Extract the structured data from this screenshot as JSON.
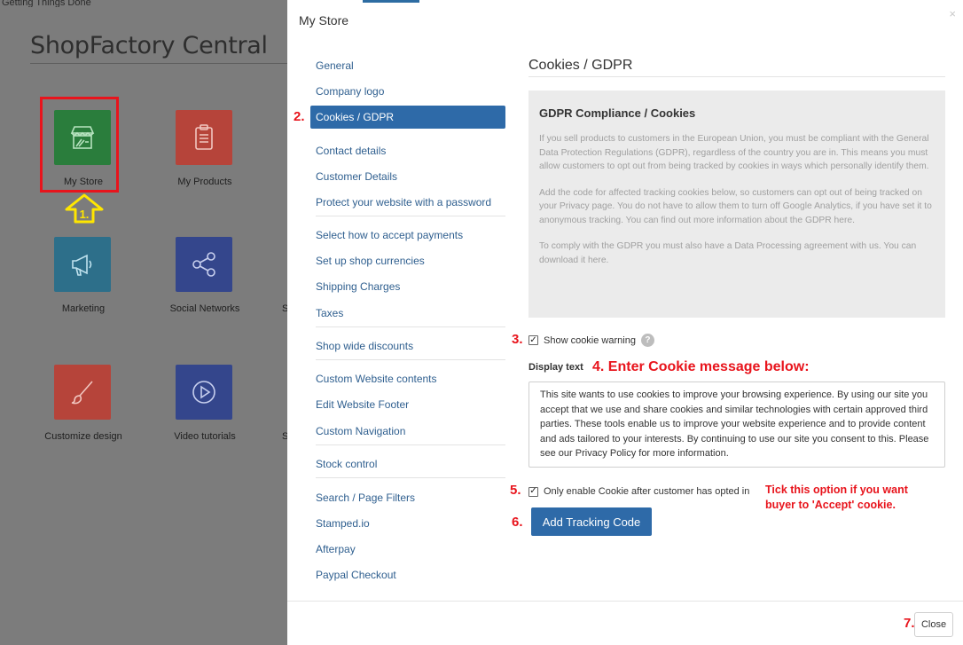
{
  "background_app": {
    "top_text": "Getting Things Done",
    "title": "ShopFactory Central",
    "tiles": [
      {
        "label": "My Store",
        "icon": "storefront-icon",
        "color": "#2a7d3c"
      },
      {
        "label": "My Products",
        "icon": "clipboard-icon",
        "color": "#b6443a"
      },
      {
        "label": "Marketing",
        "icon": "megaphone-icon",
        "color": "#2d6f8a"
      },
      {
        "label": "Social Networks",
        "icon": "share-icon",
        "color": "#34468c"
      },
      {
        "label": "Customize design",
        "icon": "brush-icon",
        "color": "#b6443a"
      },
      {
        "label": "Video tutorials",
        "icon": "play-icon",
        "color": "#34468c"
      }
    ],
    "cut_letters": [
      "S",
      "S"
    ]
  },
  "modal": {
    "title": "My Store",
    "close_x": "×",
    "nav": {
      "items": [
        {
          "label": "General"
        },
        {
          "label": "Company logo"
        },
        {
          "label": "Cookies / GDPR",
          "active": true
        },
        {
          "label": "Contact details"
        },
        {
          "label": "Customer Details"
        },
        {
          "label": "Protect your website with a password"
        },
        {
          "label": "Select how to accept payments"
        },
        {
          "label": "Set up shop currencies"
        },
        {
          "label": "Shipping Charges"
        },
        {
          "label": "Taxes"
        },
        {
          "label": "Shop wide discounts"
        },
        {
          "label": "Custom Website contents"
        },
        {
          "label": "Edit Website Footer"
        },
        {
          "label": "Custom Navigation"
        },
        {
          "label": "Stock control"
        },
        {
          "label": "Search / Page Filters"
        },
        {
          "label": "Stamped.io"
        },
        {
          "label": "Afterpay"
        },
        {
          "label": "Paypal Checkout"
        }
      ]
    },
    "content": {
      "section_title": "Cookies / GDPR",
      "info_title": "GDPR Compliance / Cookies",
      "info_paragraphs": [
        "If you sell products to customers in the European Union, you must be compliant with the General Data Protection Regulations (GDPR), regardless of the country you are in. This means you must allow customers to opt out from being tracked by cookies in ways which personally identify them.",
        "Add the code for affected tracking cookies below, so customers can opt out of being tracked on your Privacy page. You do not have to allow them to turn off Google Analytics, if you have set it to anonymous tracking. You can find out more information about the GDPR here.",
        "To comply with the GDPR you must also have a Data Processing agreement with us. You can download it here."
      ],
      "show_cookie_warning": {
        "label": "Show cookie warning",
        "checked": true,
        "help": "?"
      },
      "display_text_label": "Display text",
      "display_text_value": "This site wants to use cookies to improve your browsing experience. By using our site you accept that we use and share cookies and similar technologies with certain approved third parties. These tools enable us to improve your website experience and to provide content and ads tailored to your interests. By continuing to use our site you consent to this. Please see our Privacy Policy for more information.",
      "opt_in": {
        "label": "Only enable Cookie after customer has opted in",
        "checked": true
      },
      "add_tracking_button": "Add Tracking Code"
    },
    "close_button": "Close"
  },
  "annotations": {
    "step1": "1.",
    "step2": "2.",
    "step3": "3.",
    "step4": "4. Enter Cookie message below:",
    "step5": "5.",
    "step6": "6.",
    "step7": "7.",
    "tip_line1": "Tick this option if you want",
    "tip_line2": "buyer to 'Accept' cookie."
  },
  "colors": {
    "accent": "#2e6aa8",
    "annotation_red": "#e8141c",
    "annotation_yellow": "#ffe600"
  }
}
